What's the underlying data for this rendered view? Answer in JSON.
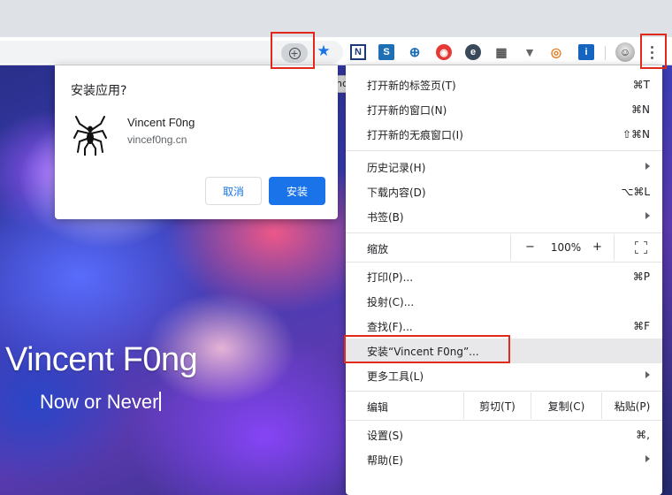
{
  "page": {
    "hero_title": "Vincent F0ng",
    "hero_subtitle": "Now or Never"
  },
  "toolbar": {
    "install_icon": "plus-circle-icon",
    "bookmark_icon": "star-icon",
    "extensions": [
      {
        "name": "extension-n-icon",
        "glyph": "N"
      },
      {
        "name": "extension-s-icon",
        "glyph": "S"
      },
      {
        "name": "extension-globe-icon",
        "glyph": "⊕"
      },
      {
        "name": "extension-red-icon",
        "glyph": "●"
      },
      {
        "name": "extension-e-icon",
        "glyph": "e"
      },
      {
        "name": "extension-grid-icon",
        "glyph": "▦"
      },
      {
        "name": "extension-v-icon",
        "glyph": "▼"
      },
      {
        "name": "extension-rss-icon",
        "glyph": "◉"
      },
      {
        "name": "extension-i-icon",
        "glyph": "i"
      }
    ],
    "tooltip": "安装“Vincent F0ng”"
  },
  "dialog": {
    "title": "安装应用?",
    "app_name": "Vincent F0ng",
    "app_url": "vincef0ng.cn",
    "cancel_label": "取消",
    "install_label": "安装"
  },
  "menu": {
    "new_tab": {
      "label": "打开新的标签页(T)",
      "shortcut": "⌘T"
    },
    "new_window": {
      "label": "打开新的窗口(N)",
      "shortcut": "⌘N"
    },
    "new_incognito": {
      "label": "打开新的无痕窗口(I)",
      "shortcut": "⇧⌘N"
    },
    "history": {
      "label": "历史记录(H)"
    },
    "downloads": {
      "label": "下载内容(D)",
      "shortcut": "⌥⌘L"
    },
    "bookmarks": {
      "label": "书签(B)"
    },
    "zoom": {
      "label": "缩放",
      "minus": "−",
      "value": "100%",
      "plus": "+"
    },
    "print": {
      "label": "打印(P)...",
      "shortcut": "⌘P"
    },
    "cast": {
      "label": "投射(C)..."
    },
    "find": {
      "label": "查找(F)...",
      "shortcut": "⌘F"
    },
    "install_app": {
      "label": "安装“Vincent F0ng”..."
    },
    "more_tools": {
      "label": "更多工具(L)"
    },
    "edit": {
      "label": "编辑",
      "cut": "剪切(T)",
      "copy": "复制(C)",
      "paste": "粘贴(P)"
    },
    "settings": {
      "label": "设置(S)",
      "shortcut": "⌘,"
    },
    "help": {
      "label": "帮助(E)"
    }
  },
  "colors": {
    "highlight_box": "#e0281b",
    "accent": "#1a73e8",
    "menu_hover": "#e8e8ea"
  }
}
